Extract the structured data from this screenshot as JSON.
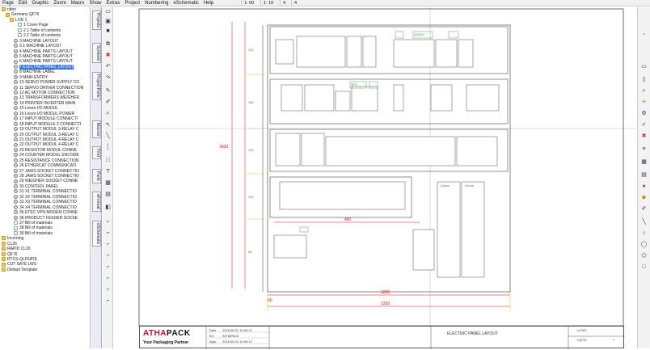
{
  "menu": [
    "Page",
    "Edit",
    "Graphic",
    "Zoom",
    "Macro",
    "Show",
    "Extras",
    "Project",
    "Numbering",
    "eSchematic",
    "Help"
  ],
  "status": {
    "coords": "1: 60",
    "v2": "1: 10",
    "v3": "4",
    "v4": "4"
  },
  "tree": {
    "items": [
      {
        "label": "niferi",
        "icon": "folder",
        "indent": 0
      },
      {
        "label": "Germany QF76",
        "icon": "folder",
        "indent": 1
      },
      {
        "label": "LOD 1",
        "icon": "folder",
        "indent": 2
      },
      {
        "label": "1 Cover Page",
        "icon": "page",
        "indent": 4
      },
      {
        "label": "2.1 Table of contents",
        "icon": "page",
        "indent": 4
      },
      {
        "label": "2.2 Table of contents",
        "icon": "page",
        "indent": 4
      },
      {
        "label": "3 MACHINE LAYOUT",
        "icon": "gear",
        "indent": 3
      },
      {
        "label": "3.1 MACHINE LAYOUT",
        "icon": "gear",
        "indent": 3
      },
      {
        "label": "4 MACHINE PARTS LAYOUT",
        "icon": "gear",
        "indent": 3
      },
      {
        "label": "5 MACHINE PARTS LAYOUT",
        "icon": "gear",
        "indent": 3
      },
      {
        "label": "6 MACHINE PARTS LAYOUT",
        "icon": "gear",
        "indent": 3
      },
      {
        "label": "7 ELECTRIC PANEL LAYOUT",
        "icon": "gear",
        "indent": 3,
        "selected": true
      },
      {
        "label": "8 MACHINE LABEL",
        "icon": "gear",
        "indent": 3
      },
      {
        "label": "9 MAIN ENTRY",
        "icon": "gear",
        "indent": 3
      },
      {
        "label": "10 SERVO POWER SUPPLY CO",
        "icon": "gear",
        "indent": 3
      },
      {
        "label": "11 SERVO DRIVER CONNECTION",
        "icon": "gear",
        "indent": 3
      },
      {
        "label": "12 AC MOTOR CONNECTION",
        "icon": "gear",
        "indent": 3
      },
      {
        "label": "13 TRANSFORMERS WEIGHER",
        "icon": "gear",
        "indent": 3
      },
      {
        "label": "14 PRINTER INVERTER MAIN",
        "icon": "gear",
        "indent": 3
      },
      {
        "label": "15 Lenze I/O MODUL",
        "icon": "gear",
        "indent": 3
      },
      {
        "label": "16 Lenze I/O MODUL POWER",
        "icon": "gear",
        "indent": 3
      },
      {
        "label": "17 INPUT MODULE CONNECTI",
        "icon": "gear",
        "indent": 3
      },
      {
        "label": "18 INPUT MODULE 2 CONNECTI",
        "icon": "gear",
        "indent": 3
      },
      {
        "label": "19 OUTPUT MODUL 3-RELAY C",
        "icon": "gear",
        "indent": 3
      },
      {
        "label": "20 OUTPUT MODUL 3-RELAY C",
        "icon": "gear",
        "indent": 3
      },
      {
        "label": "21 OUTPUT MODUL 4-RELAY C",
        "icon": "gear",
        "indent": 3
      },
      {
        "label": "22 OUTPUT MODUL 4-RELAY C",
        "icon": "gear",
        "indent": 3
      },
      {
        "label": "23 RESISTOR MODUL CONNE",
        "icon": "gear",
        "indent": 3
      },
      {
        "label": "24 COUNTER MODUL ENCODE",
        "icon": "gear",
        "indent": 3
      },
      {
        "label": "25 RESISTANCE CONNECTION",
        "icon": "gear",
        "indent": 3
      },
      {
        "label": "26 ETHERCAT COMMUNICATI",
        "icon": "gear",
        "indent": 3
      },
      {
        "label": "27 JAWS SOCKET CONNECTIO",
        "icon": "gear",
        "indent": 3
      },
      {
        "label": "28 JAWS SOCKET CONNECTIO",
        "icon": "gear",
        "indent": 3
      },
      {
        "label": "29 WEIGHER SOCKET CONNE",
        "icon": "gear",
        "indent": 3
      },
      {
        "label": "30 CONTROL PANEL",
        "icon": "gear",
        "indent": 3
      },
      {
        "label": "31 X1 TERMINAL CONNECTIO",
        "icon": "gear",
        "indent": 3
      },
      {
        "label": "32 X2 TERMINAL CONNECTIO",
        "icon": "gear",
        "indent": 3
      },
      {
        "label": "33 X3 TERMINAL CONNECTIO",
        "icon": "gear",
        "indent": 3
      },
      {
        "label": "34 X4 TERMINAL CONNECTIO",
        "icon": "gear",
        "indent": 3
      },
      {
        "label": "35 ETEC VPN MODEM CONNE",
        "icon": "gear",
        "indent": 3
      },
      {
        "label": "36 PRODUCT FEEDER SOCKE",
        "icon": "gear",
        "indent": 3
      },
      {
        "label": "37 Bill of materials",
        "icon": "page",
        "indent": 3
      },
      {
        "label": "38 Bill of materials",
        "icon": "page",
        "indent": 3
      },
      {
        "label": "39 Bill of materials",
        "icon": "page",
        "indent": 3
      },
      {
        "label": "Incoming",
        "icon": "folder",
        "indent": 0
      },
      {
        "label": "CL26",
        "icon": "folder",
        "indent": 0
      },
      {
        "label": "RAPID CL26",
        "icon": "folder",
        "indent": 0
      },
      {
        "label": "QF76",
        "icon": "folder",
        "indent": 0
      },
      {
        "label": "RTCS-QLF6ATE",
        "icon": "folder",
        "indent": 0
      },
      {
        "label": "CUT SATE LWS",
        "icon": "folder",
        "indent": 0
      },
      {
        "label": "Default Template",
        "icon": "folder",
        "indent": 0
      }
    ]
  },
  "vtabs": [
    "Projects",
    "Symbols",
    "Project Parts",
    "Macros",
    "Find",
    "Parts",
    "eFormat",
    "eSchematic"
  ],
  "drawing": {
    "row_labels": [
      "120",
      "160",
      "120",
      "120",
      "98"
    ],
    "height_dim": "1600",
    "width_dim_inner": "1200",
    "width_dim_outer": "1200",
    "bottom_small": "60",
    "span_dim": "480",
    "labels_green": [
      "24VDC",
      "QF1",
      "Lenze",
      "Lenze"
    ],
    "module_tags": [
      "A1",
      "A2",
      "A3"
    ]
  },
  "title_block": {
    "logo_part1": "ATHA",
    "logo_part2": "PACK",
    "tagline": "Your Packaging Partner",
    "date_label": "Date",
    "date_value": "2018.06.01 14:06:12",
    "ed_label": "Ed.",
    "ed_value": "ATHAPACK",
    "appr_label": "Appr.",
    "appr_value": "2018.06.01 14:06:12",
    "title": "ELECTRIC PANEL LAYOUT",
    "sheet": "=LOD1",
    "page": "+QF76",
    "page_no": "7"
  }
}
